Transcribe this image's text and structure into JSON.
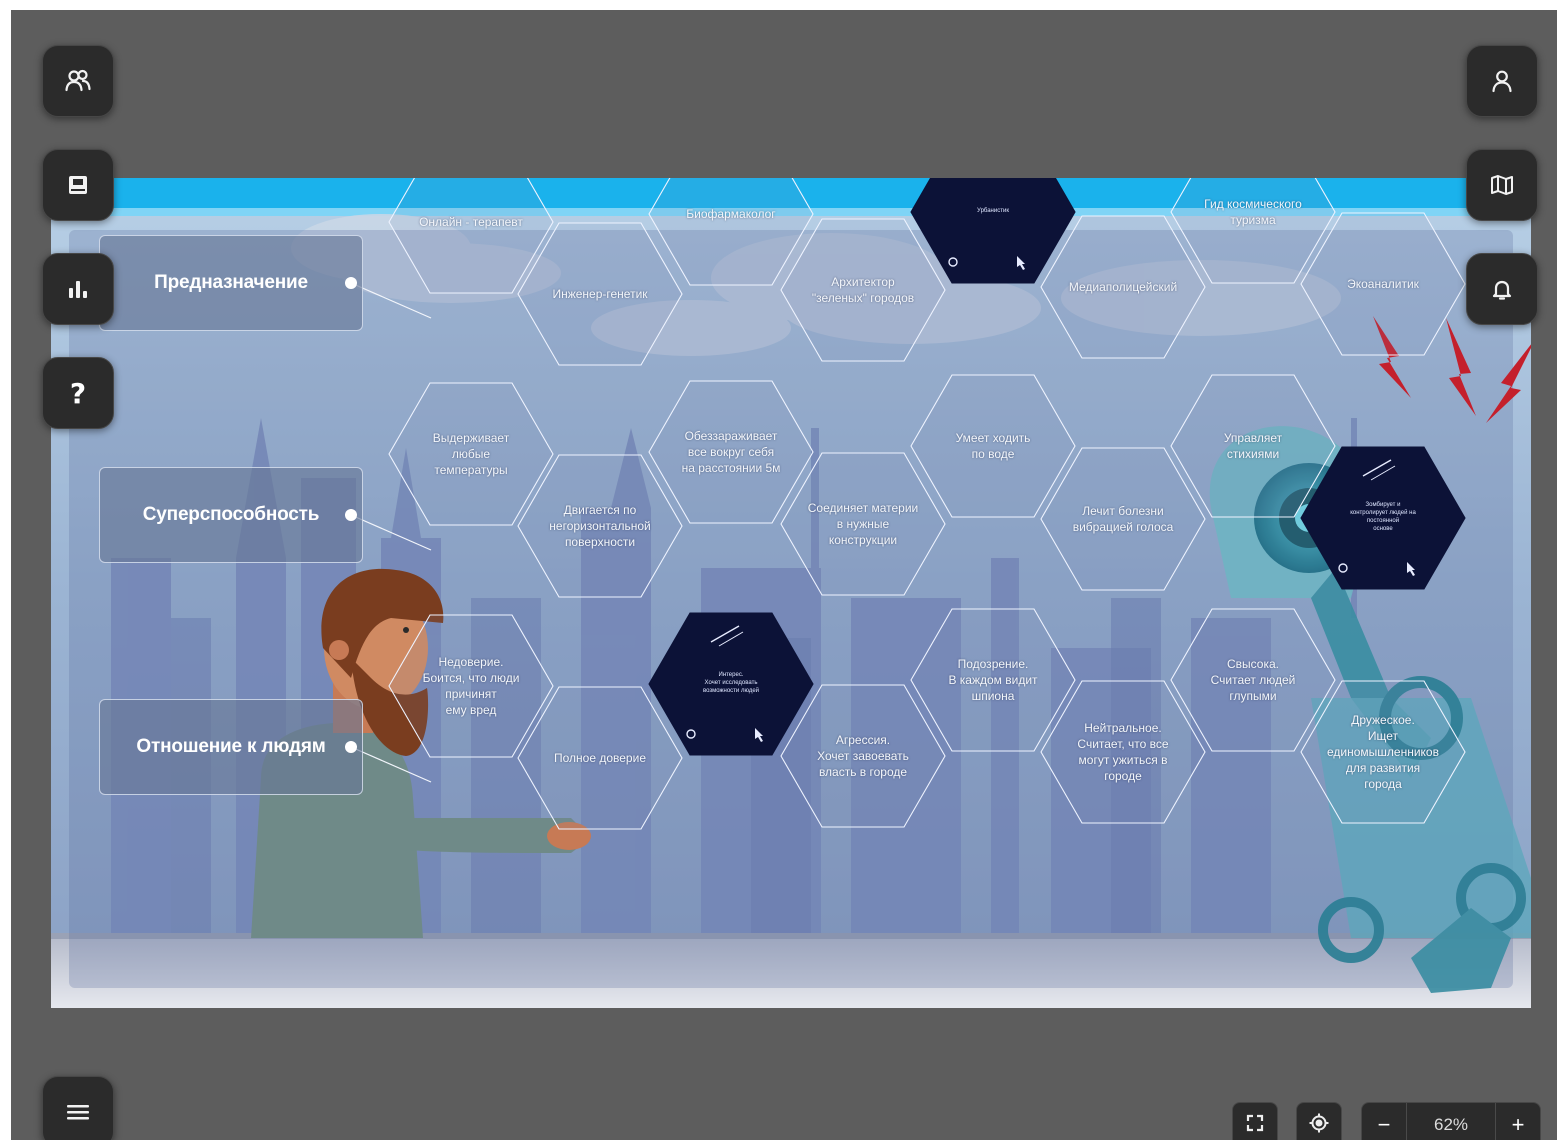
{
  "rows": [
    {
      "label": "Предназначение"
    },
    {
      "label": "Суперспособность"
    },
    {
      "label": "Отношение к людям"
    }
  ],
  "hex_rows": [
    {
      "cards": [
        {
          "text": "Онлайн - терапевт"
        },
        {
          "text": "Инженер-генетик"
        },
        {
          "text": "Биофармаколог"
        },
        {
          "text": "Архитектор\n\"зеленых\" городов"
        },
        {
          "text": "Урбанистик",
          "dark": true
        },
        {
          "text": "Медиаполицейский"
        },
        {
          "text": "Гид космического\nтуризма"
        },
        {
          "text": "Экоаналитик"
        }
      ]
    },
    {
      "cards": [
        {
          "text": "Выдерживает\nлюбые\nтемпературы"
        },
        {
          "text": "Двигается по\nнегоризонтальной\nповерхности"
        },
        {
          "text": "Обеззараживает\nвсе вокруг себя\nна расстоянии 5м"
        },
        {
          "text": "Соединяет материи\nв нужные\nконструкции"
        },
        {
          "text": "Умеет ходить\nпо воде"
        },
        {
          "text": "Лечит болезни\nвибрацией голоса"
        },
        {
          "text": "Управляет\nстихиями"
        },
        {
          "text": "Зомбирует и\nконтролирует людей на\nпостоянной\nоснове",
          "dark": true
        }
      ]
    },
    {
      "cards": [
        {
          "text": "Недоверие.\nБоится, что люди\nпричинят\nему вред"
        },
        {
          "text": "Полное доверие"
        },
        {
          "text": "Интерес.\nХочет исследовать\nвозможности людей",
          "dark": true
        },
        {
          "text": "Агрессия.\nХочет завоевать\nвласть в городе"
        },
        {
          "text": "Подозрение.\nВ каждом видит\nшпиона"
        },
        {
          "text": "Нейтральное.\nСчитает, что все\nмогут ужиться в\nгороде"
        },
        {
          "text": "Свысока.\nСчитает людей\nглупыми"
        },
        {
          "text": "Дружеское.\nИщет\nединомышленников\nдля развития\nгорода"
        }
      ]
    }
  ],
  "icons": {
    "team": "users-icon",
    "notebook": "book-icon",
    "stats": "bar-chart-icon",
    "help": "help-icon",
    "help_glyph": "?",
    "profile": "user-icon",
    "map": "map-icon",
    "notifications": "bell-icon",
    "menu": "hamburger-menu-icon",
    "fullscreen": "fullscreen-icon",
    "recenter": "crosshair-icon"
  },
  "zoom": {
    "minus": "−",
    "value": "62%",
    "plus": "+"
  },
  "colors": {
    "app_bg": "#5d5d5d",
    "button_bg": "#2b2b2b",
    "banner": "#1ab2ec",
    "dark_hex": "#0c1237",
    "hex_stroke": "#eef3ff",
    "lightning": "#c4202c"
  }
}
